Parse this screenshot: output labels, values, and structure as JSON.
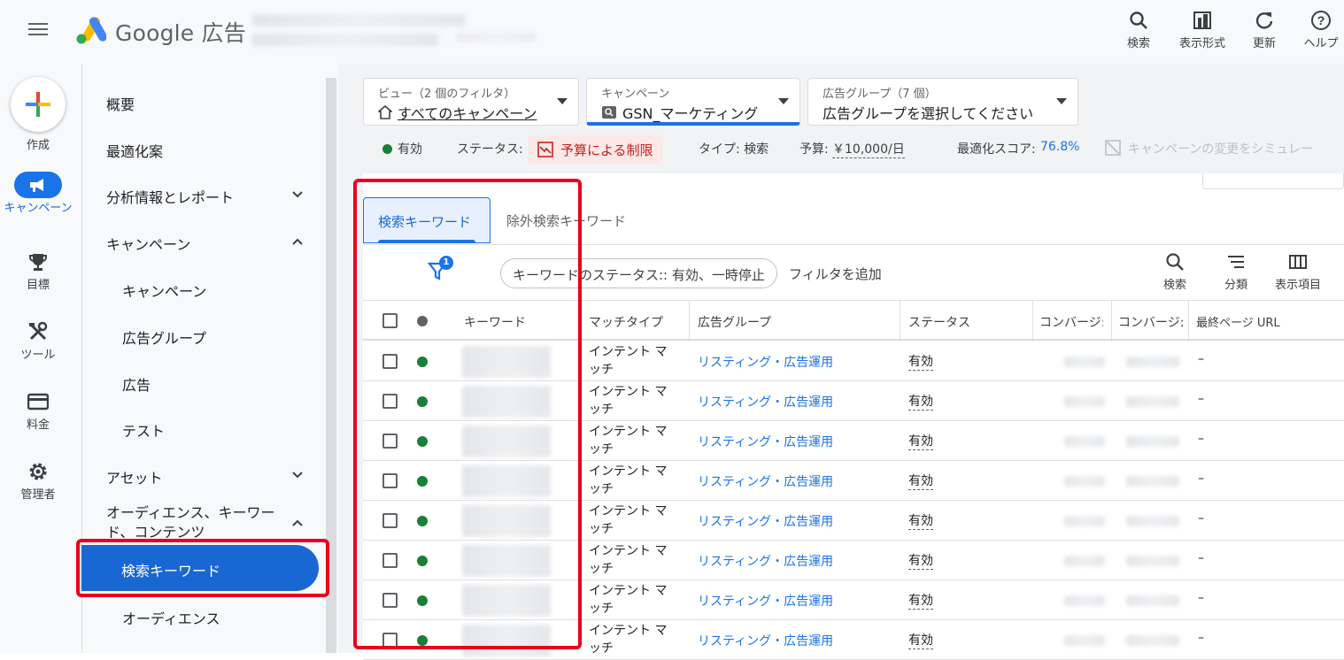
{
  "header": {
    "brand": "Google 広告",
    "tools": [
      {
        "name": "search",
        "label": "検索"
      },
      {
        "name": "view",
        "label": "表示形式"
      },
      {
        "name": "refresh",
        "label": "更新"
      },
      {
        "name": "help",
        "label": "ヘルプ"
      }
    ]
  },
  "rail": {
    "create_label": "作成",
    "items": [
      {
        "label": "キャンペーン",
        "icon": "megaphone-icon",
        "active": true
      },
      {
        "label": "目標",
        "icon": "trophy-icon"
      },
      {
        "label": "ツール",
        "icon": "tools-icon"
      },
      {
        "label": "料金",
        "icon": "credit-card-icon"
      },
      {
        "label": "管理者",
        "icon": "gear-icon"
      }
    ]
  },
  "nav": {
    "overview": "概要",
    "recommendations": "最適化案",
    "insights": "分析情報とレポート",
    "campaigns_group": "キャンペーン",
    "campaigns": "キャンペーン",
    "ad_groups": "広告グループ",
    "ads": "広告",
    "tests": "テスト",
    "assets": "アセット",
    "audience_group": "オーディエンス、キーワード、コンテンツ",
    "search_keywords": "検索キーワード",
    "audiences": "オーディエンス"
  },
  "filters": {
    "view_label": "ビュー（2 個のフィルタ）",
    "view_value": "すべてのキャンペーン",
    "campaign_label": "キャンペーン",
    "campaign_value": "GSN_マーケティング",
    "adgroup_label": "広告グループ（7 個）",
    "adgroup_value": "広告グループを選択してください"
  },
  "status_bar": {
    "enabled": "有効",
    "status_label": "ステータス:",
    "status_value": "予算による制限",
    "type": "タイプ: 検索",
    "budget_label": "予算:",
    "budget_value": "￥10,000/日",
    "score_label": "最適化スコア:",
    "score_value": "76.8%",
    "simulate": "キャンペーンの変更をシミュレー"
  },
  "tabs": {
    "active": "検索キーワード",
    "negative": "除外検索キーワード"
  },
  "toolbar": {
    "filter_count": "1",
    "chip": "キーワードのステータス:: 有効、一時停止",
    "add_filter": "フィルタを追加",
    "search": "検索",
    "segment": "分類",
    "columns": "表示項目"
  },
  "table": {
    "headers": {
      "keyword": "キーワード",
      "match": "マッチタイプ",
      "adgroup": "広告グループ",
      "status": "ステータス",
      "conv1": "コンバージ:",
      "conv2": "コンバージ:",
      "url": "最終ページ URL"
    },
    "rows": [
      {
        "match1": "インテント マ",
        "match2": "ッチ",
        "adgroup": "リスティング・広告運用",
        "status": "有効",
        "url": "–"
      },
      {
        "match1": "インテント マ",
        "match2": "ッチ",
        "adgroup": "リスティング・広告運用",
        "status": "有効",
        "url": "–"
      },
      {
        "match1": "インテント マ",
        "match2": "ッチ",
        "adgroup": "リスティング・広告運用",
        "status": "有効",
        "url": "–"
      },
      {
        "match1": "インテント マ",
        "match2": "ッチ",
        "adgroup": "リスティング・広告運用",
        "status": "有効",
        "url": "–"
      },
      {
        "match1": "インテント マ",
        "match2": "ッチ",
        "adgroup": "リスティング・広告運用",
        "status": "有効",
        "url": "–"
      },
      {
        "match1": "インテント マ",
        "match2": "ッチ",
        "adgroup": "リスティング・広告運用",
        "status": "有効",
        "url": "–"
      },
      {
        "match1": "インテント マ",
        "match2": "ッチ",
        "adgroup": "リスティング・広告運用",
        "status": "有効",
        "url": "–"
      },
      {
        "match1": "インテント マ",
        "match2": "ッチ",
        "adgroup": "リスティング・広告運用",
        "status": "有効",
        "url": "–"
      }
    ]
  },
  "colors": {
    "accent": "#1a73e8",
    "active_nav": "#1967d2",
    "enabled_dot": "#188038",
    "highlight": "#e8001c"
  }
}
